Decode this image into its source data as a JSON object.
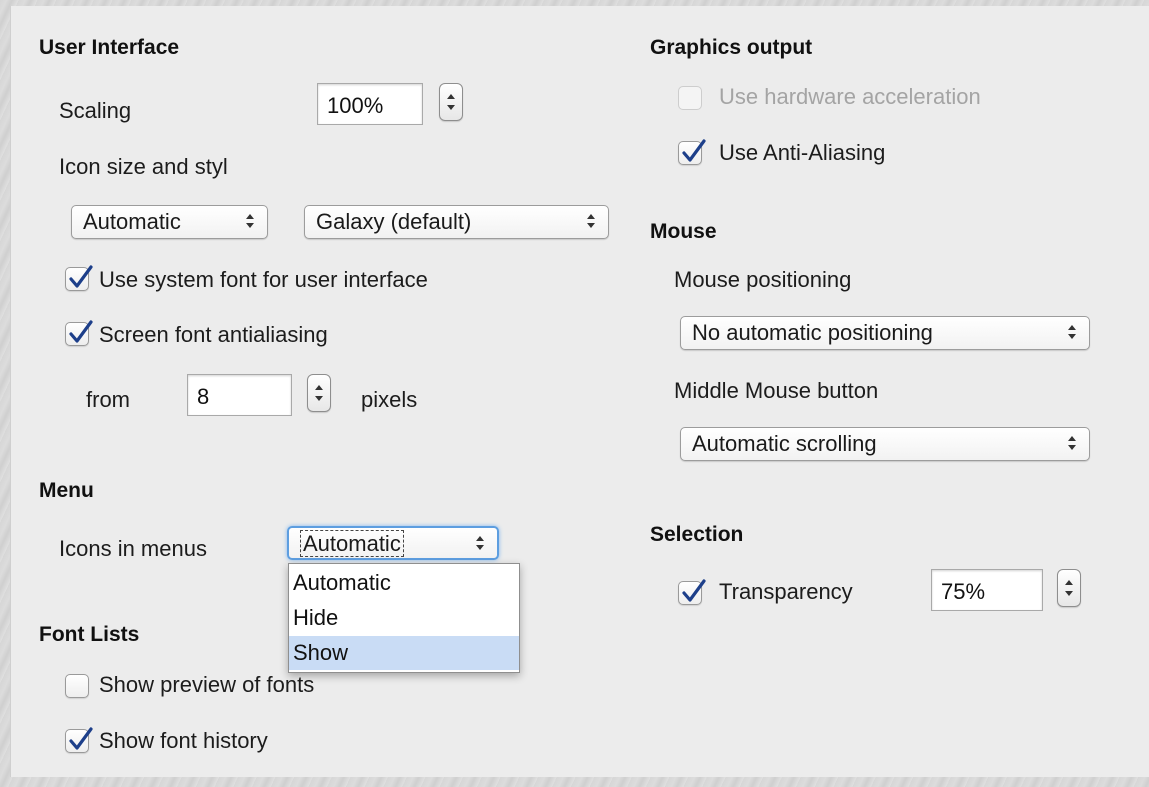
{
  "user_interface": {
    "heading": "User Interface",
    "scaling_label": "Scaling",
    "scaling_value": "100%",
    "icon_size_label": "Icon size and styl",
    "icon_size_value": "Automatic",
    "icon_style_value": "Galaxy (default)",
    "use_system_font_label": "Use system font for user interface",
    "use_system_font_checked": true,
    "screen_antialiasing_label": "Screen font antialiasing",
    "screen_antialiasing_checked": true,
    "from_label": "from",
    "from_value": "8",
    "pixels_label": "pixels"
  },
  "menu": {
    "heading": "Menu",
    "icons_in_menus_label": "Icons in menus",
    "icons_in_menus_value": "Automatic",
    "options": [
      "Automatic",
      "Hide",
      "Show"
    ],
    "highlighted_option": "Show"
  },
  "font_lists": {
    "heading": "Font Lists",
    "show_preview_label": "Show preview of fonts",
    "show_preview_checked": false,
    "show_history_label": "Show font history",
    "show_history_checked": true
  },
  "graphics_output": {
    "heading": "Graphics output",
    "hardware_accel_label": "Use hardware acceleration",
    "hardware_accel_checked": false,
    "hardware_accel_enabled": false,
    "anti_aliasing_label": "Use Anti-Aliasing",
    "anti_aliasing_checked": true
  },
  "mouse": {
    "heading": "Mouse",
    "positioning_label": "Mouse positioning",
    "positioning_value": "No automatic positioning",
    "middle_button_label": "Middle Mouse button",
    "middle_button_value": "Automatic scrolling"
  },
  "selection": {
    "heading": "Selection",
    "transparency_label": "Transparency",
    "transparency_checked": true,
    "transparency_value": "75%"
  },
  "colors": {
    "check_mark": "#1d3f8a",
    "focus_ring": "#5d9ee0",
    "menu_highlight": "#c9dcf5"
  }
}
